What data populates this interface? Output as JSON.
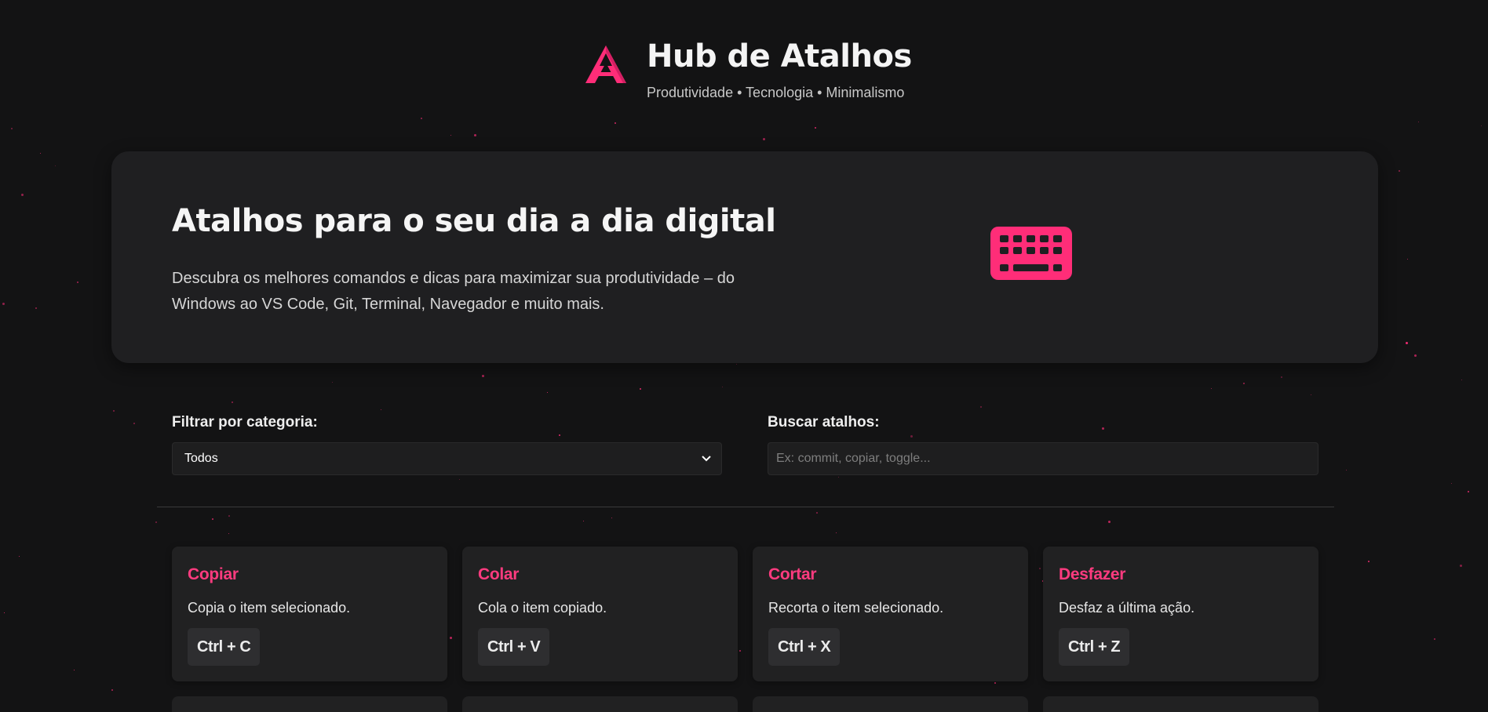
{
  "brand": {
    "title": "Hub de Atalhos",
    "subtitle": "Produtividade • Tecnologia • Minimalismo",
    "logo_icon": "letter-a-logo",
    "accent_color": "#ff2d78"
  },
  "hero": {
    "title": "Atalhos para o seu dia a dia digital",
    "description": "Descubra os melhores comandos e dicas para maximizar sua produtividade – do Windows ao VS Code, Git, Terminal, Navegador e muito mais.",
    "icon": "keyboard-icon"
  },
  "filters": {
    "category_label": "Filtrar por categoria:",
    "category_selected": "Todos",
    "search_label": "Buscar atalhos:",
    "search_placeholder": "Ex: commit, copiar, toggle...",
    "search_value": ""
  },
  "shortcuts": [
    {
      "title": "Copiar",
      "description": "Copia o item selecionado.",
      "keys": "Ctrl + C"
    },
    {
      "title": "Colar",
      "description": "Cola o item copiado.",
      "keys": "Ctrl + V"
    },
    {
      "title": "Cortar",
      "description": "Recorta o item selecionado.",
      "keys": "Ctrl + X"
    },
    {
      "title": "Desfazer",
      "description": "Desfaz a última ação.",
      "keys": "Ctrl + Z"
    }
  ]
}
